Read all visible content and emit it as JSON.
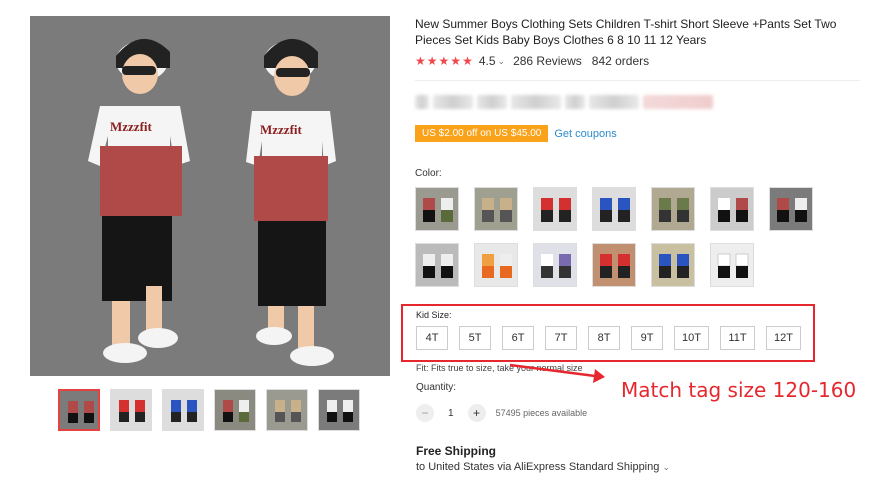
{
  "product": {
    "title": "New Summer Boys Clothing Sets Children T-shirt Short Sleeve +Pants Set Two Pieces Set Kids Baby Boys Clothes 6 8 10 11 12 Years",
    "rating": "4.5",
    "rating_chevron": "⌄",
    "reviews": "286 Reviews",
    "orders": "842 orders",
    "stars": 5
  },
  "coupon": {
    "badge": "US $2.00 off on US $45.00",
    "link": "Get coupons"
  },
  "colors": {
    "brand_red": "#e6282e",
    "coupon_orange": "#f9a21a",
    "link_blue": "#2c8bd0",
    "star_red": "#f0484b"
  },
  "color_section": {
    "label": "Color:",
    "swatches": 13
  },
  "size_section": {
    "label": "Kid Size:",
    "sizes": [
      "4T",
      "5T",
      "6T",
      "7T",
      "8T",
      "9T",
      "10T",
      "11T",
      "12T"
    ],
    "fit": "Fit: Fits true to size, take your normal size"
  },
  "quantity": {
    "label": "Quantity:",
    "minus": "−",
    "value": "1",
    "plus": "+",
    "available": "57495 pieces available"
  },
  "shipping": {
    "title": "Free Shipping",
    "detail": "to United States via AliExpress Standard Shipping",
    "chevron": "⌄"
  },
  "annotation": {
    "text": "Match tag size 120-160"
  },
  "thumbnails": 6
}
